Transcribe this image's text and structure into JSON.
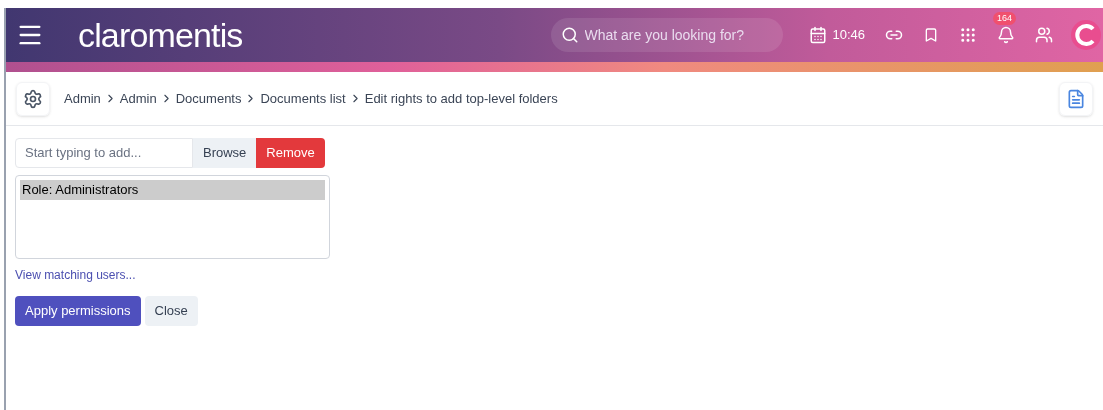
{
  "header": {
    "logo": "claromentis",
    "search": {
      "placeholder": "What are you looking for?"
    },
    "time": "10:46",
    "notifications_badge": "164"
  },
  "breadcrumb": [
    "Admin",
    "Admin",
    "Documents",
    "Documents list",
    "Edit rights to add top-level folders"
  ],
  "picker": {
    "placeholder": "Start typing to add...",
    "buttons": [
      "Browse",
      "Remove"
    ]
  },
  "assigned": [
    {
      "label": "Role: Administrators",
      "selected": true
    }
  ],
  "link": "View matching users...",
  "actions": [
    {
      "label": "Apply permissions",
      "kind": "primary"
    },
    {
      "label": "Close",
      "kind": "secondary"
    }
  ]
}
